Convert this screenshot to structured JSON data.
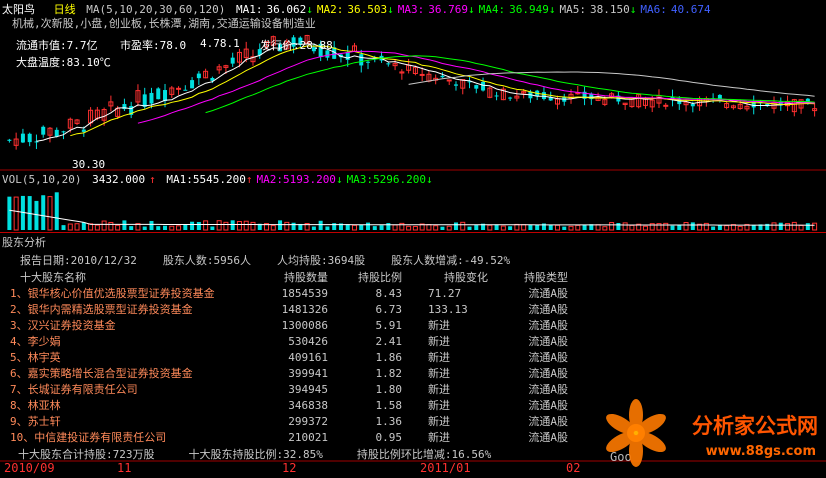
{
  "window": {
    "stock_name": "太阳鸟",
    "period": "日线"
  },
  "price_header": {
    "ma_params": "MA(5,10,20,30,60,120)",
    "items": [
      {
        "label": "MA1:",
        "value": "36.062",
        "arrow": "↓",
        "color": "#ffffff"
      },
      {
        "label": "MA2:",
        "value": "36.503",
        "arrow": "↓",
        "color": "#ffff00"
      },
      {
        "label": "MA3:",
        "value": "36.769",
        "arrow": "↓",
        "color": "#ff00ff"
      },
      {
        "label": "MA4:",
        "value": "36.949",
        "arrow": "↓",
        "color": "#00ff00"
      },
      {
        "label": "MA5:",
        "value": "38.150",
        "arrow": "↓",
        "color": "#c8c8c8"
      },
      {
        "label": "MA6:",
        "value": "40.674",
        "arrow": "",
        "color": "#4060ff"
      }
    ]
  },
  "concepts": "机械,次新股,小盘,创业板,长株潭,湖南,交通运输设备制造业",
  "info": {
    "circulating_cap": "流通市值:7.7亿",
    "pe": "市盈率:78.0",
    "pe_extra": "4.78.1",
    "issue_price": "发行价:28.88",
    "market_temp": "大盘温度:83.10℃",
    "low_label": "30.30"
  },
  "vol_header": {
    "params": "VOL(5,10,20)",
    "value": "3432.000",
    "value_arrow": "↑",
    "items": [
      {
        "label": "MA1:",
        "value": "5545.200",
        "arrow": "↑",
        "color": "#ffffff"
      },
      {
        "label": "MA2:",
        "value": "5193.200",
        "arrow": "↓",
        "color": "#ff00ff"
      },
      {
        "label": "MA3:",
        "value": "5296.200",
        "arrow": "↓",
        "color": "#00ff00"
      }
    ]
  },
  "panel": {
    "title": "股东分析",
    "summary": {
      "report_date": "报告日期:2010/12/32",
      "holder_count": "股东人数:5956人",
      "avg_holding": "人均持股:3694股",
      "holder_change": "股东人数增减:-49.52%"
    },
    "table": {
      "headers": [
        "十大股东名称",
        "持股数量",
        "持股比例",
        "持股变化",
        "持股类型"
      ],
      "rows": [
        [
          "1、银华核心价值优选股票型证券投资基金",
          "1854539",
          "8.43",
          "71.27",
          "流通A股"
        ],
        [
          "2、银华内需精选股票型证券投资基金",
          "1481326",
          "6.73",
          "133.13",
          "流通A股"
        ],
        [
          "3、汉兴证券投资基金",
          "1300086",
          "5.91",
          "新进",
          "流通A股"
        ],
        [
          "4、李少娟",
          "530426",
          "2.41",
          "新进",
          "流通A股"
        ],
        [
          "5、林宇英",
          "409161",
          "1.86",
          "新进",
          "流通A股"
        ],
        [
          "6、嘉实策略增长混合型证券投资基金",
          "399941",
          "1.82",
          "新进",
          "流通A股"
        ],
        [
          "7、长城证券有限责任公司",
          "394945",
          "1.80",
          "新进",
          "流通A股"
        ],
        [
          "8、林亚林",
          "346838",
          "1.58",
          "新进",
          "流通A股"
        ],
        [
          "9、苏士轩",
          "299372",
          "1.36",
          "新进",
          "流通A股"
        ],
        [
          "10、中信建投证券有限责任公司",
          "210021",
          "0.95",
          "新进",
          "流通A股"
        ]
      ]
    },
    "footer": {
      "total_holding": "十大股东合计持股:723万股",
      "total_ratio": "十大股东持股比例:32.85%",
      "ratio_change": "持股比例环比增减:16.56%"
    }
  },
  "time_axis": {
    "labels": [
      {
        "text": "2010/09"
      },
      {
        "text": "11"
      },
      {
        "text": "12"
      },
      {
        "text": "2011/01"
      },
      {
        "text": "02"
      }
    ]
  },
  "watermark": {
    "logo_text": "分析家公式网",
    "url": "www.88gs.com",
    "extra": "Goo"
  },
  "chart_data": {
    "type": "candlestick",
    "title": "",
    "price_range": [
      28,
      44
    ],
    "volume_range": [
      0,
      40000
    ],
    "colors": {
      "up": "#ff3030",
      "down": "#00e0e0"
    },
    "candles_sample_count": 120
  }
}
